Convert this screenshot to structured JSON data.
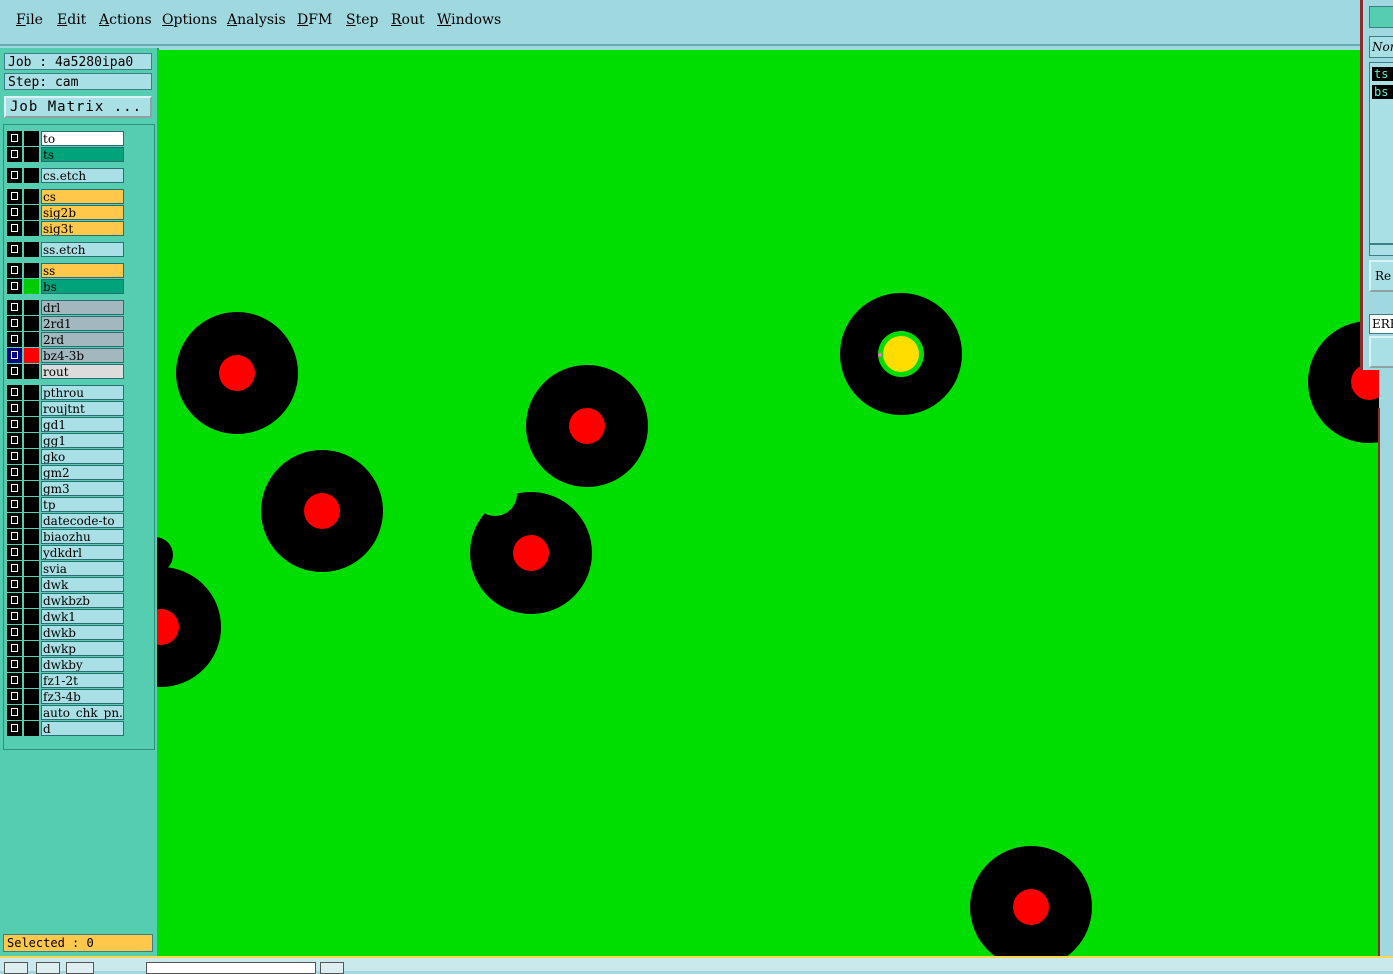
{
  "menubar": {
    "items": [
      "File",
      "Edit",
      "Actions",
      "Options",
      "Analysis",
      "DFM",
      "Step",
      "Rout",
      "Windows"
    ]
  },
  "panel": {
    "job_line": "Job : 4a5280ipa0",
    "step_line": "Step: cam",
    "job_matrix": "Job Matrix ...",
    "selected": "Selected : 0"
  },
  "layers": [
    {
      "name": "to",
      "bg": "#ffffff",
      "swatch": "#000000"
    },
    {
      "name": "ts",
      "bg": "#00a37a",
      "swatch": "#000000"
    },
    {
      "name": "cs.etch",
      "bg": "#a9e0e5",
      "swatch": "#000000"
    },
    {
      "name": "cs",
      "bg": "#ffc84a",
      "swatch": "#000000"
    },
    {
      "name": "sig2b",
      "bg": "#ffc84a",
      "swatch": "#000000"
    },
    {
      "name": "sig3t",
      "bg": "#ffc84a",
      "swatch": "#000000"
    },
    {
      "name": "ss.etch",
      "bg": "#a9e0e5",
      "swatch": "#000000"
    },
    {
      "name": "ss",
      "bg": "#ffc84a",
      "swatch": "#000000"
    },
    {
      "name": "bs",
      "bg": "#00a37a",
      "swatch": "#00cc00"
    },
    {
      "name": "drl",
      "bg": "#a2b8be",
      "swatch": "#000000"
    },
    {
      "name": "2rd1",
      "bg": "#a2b8be",
      "swatch": "#000000"
    },
    {
      "name": "2rd",
      "bg": "#a2b8be",
      "swatch": "#000000"
    },
    {
      "name": "bz4-3b",
      "bg": "#a2b8be",
      "swatch": "#ff0000"
    },
    {
      "name": "rout",
      "bg": "#dcdcdc",
      "swatch": "#000000"
    },
    {
      "name": "pthrou",
      "bg": "#a9e0e5",
      "swatch": "#000000"
    },
    {
      "name": "roujtnt",
      "bg": "#a9e0e5",
      "swatch": "#000000"
    },
    {
      "name": "gd1",
      "bg": "#a9e0e5",
      "swatch": "#000000"
    },
    {
      "name": "gg1",
      "bg": "#a9e0e5",
      "swatch": "#000000"
    },
    {
      "name": "gko",
      "bg": "#a9e0e5",
      "swatch": "#000000"
    },
    {
      "name": "gm2",
      "bg": "#a9e0e5",
      "swatch": "#000000"
    },
    {
      "name": "gm3",
      "bg": "#a9e0e5",
      "swatch": "#000000"
    },
    {
      "name": "tp",
      "bg": "#a9e0e5",
      "swatch": "#000000"
    },
    {
      "name": "datecode-to",
      "bg": "#a9e0e5",
      "swatch": "#000000"
    },
    {
      "name": "biaozhu",
      "bg": "#a9e0e5",
      "swatch": "#000000"
    },
    {
      "name": "ydkdrl",
      "bg": "#a9e0e5",
      "swatch": "#000000"
    },
    {
      "name": "svia",
      "bg": "#a9e0e5",
      "swatch": "#000000"
    },
    {
      "name": "dwk",
      "bg": "#a9e0e5",
      "swatch": "#000000"
    },
    {
      "name": "dwkbzb",
      "bg": "#a9e0e5",
      "swatch": "#000000"
    },
    {
      "name": "dwk1",
      "bg": "#a9e0e5",
      "swatch": "#000000"
    },
    {
      "name": "dwkb",
      "bg": "#a9e0e5",
      "swatch": "#000000"
    },
    {
      "name": "dwkp",
      "bg": "#a9e0e5",
      "swatch": "#000000"
    },
    {
      "name": "dwkby",
      "bg": "#a9e0e5",
      "swatch": "#000000"
    },
    {
      "name": "fz1-2t",
      "bg": "#a9e0e5",
      "swatch": "#000000"
    },
    {
      "name": "fz3-4b",
      "bg": "#a9e0e5",
      "swatch": "#000000"
    },
    {
      "name": "auto_chk_pn.",
      "bg": "#a9e0e5",
      "swatch": "#000000"
    },
    {
      "name": "d",
      "bg": "#a9e0e5",
      "swatch": "#000000"
    }
  ],
  "right_panel": {
    "field_top": "Nor",
    "list_items": [
      "ts",
      "bs"
    ],
    "button": "Re",
    "label": "ERF"
  },
  "colors": {
    "board": "#00dd00",
    "pad_clearance": "#000000",
    "drill": "#ff0000",
    "selected_pad": "#ffdd00"
  }
}
